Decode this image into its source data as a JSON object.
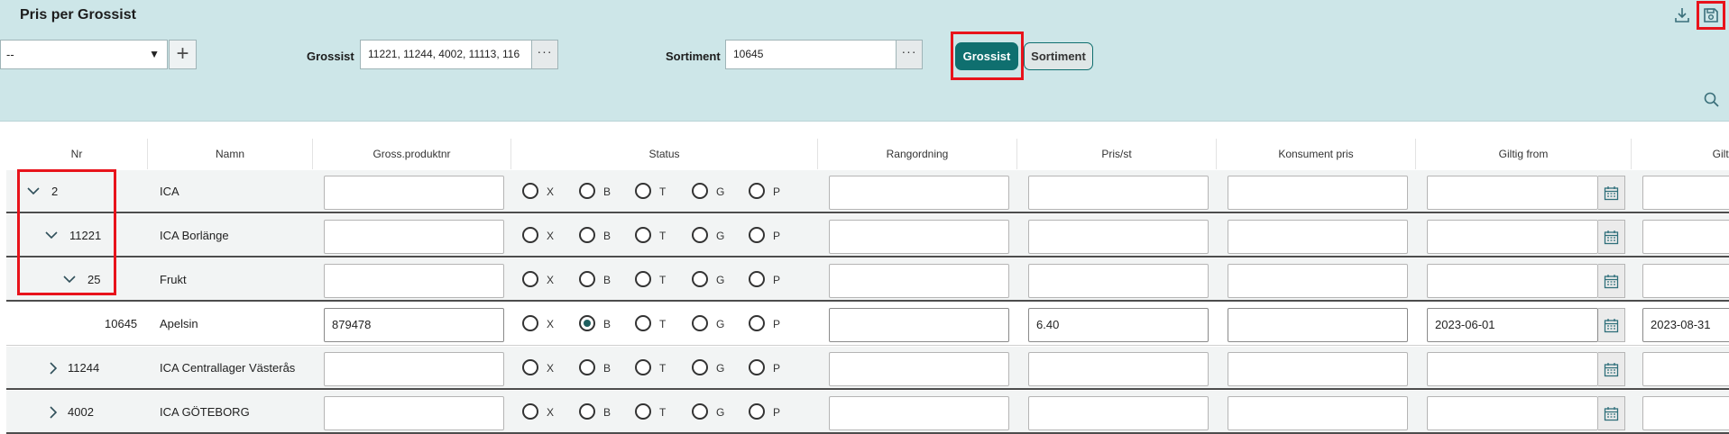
{
  "header": {
    "title": "Pris per Grossist",
    "dropdown_value": "--",
    "grossist_label": "Grossist",
    "grossist_value": "11221, 11244, 4002, 11113, 116",
    "sortiment_label": "Sortiment",
    "sortiment_value": "10645",
    "ellipsis": "···",
    "plus": "+",
    "caret": "▼",
    "btn_grossist": "Grossist",
    "btn_sortiment": "Sortiment"
  },
  "columns": [
    "Nr",
    "Namn",
    "Gross.produktnr",
    "Status",
    "Rangordning",
    "Pris/st",
    "Konsument pris",
    "Giltig from",
    "Gilti"
  ],
  "status_options": [
    "X",
    "B",
    "T",
    "G",
    "P"
  ],
  "rows": [
    {
      "chevron": "expanded",
      "nr": "2",
      "namn": "ICA",
      "gross": "",
      "status": "",
      "rang": "",
      "pris": "",
      "konsument": "",
      "from": "",
      "tom": ""
    },
    {
      "chevron": "expanded",
      "nr": "11221",
      "namn": "ICA Borlänge",
      "gross": "",
      "status": "",
      "rang": "",
      "pris": "",
      "konsument": "",
      "from": "",
      "tom": ""
    },
    {
      "chevron": "expanded",
      "nr": "25",
      "namn": "Frukt",
      "gross": "",
      "status": "",
      "rang": "",
      "pris": "",
      "konsument": "",
      "from": "",
      "tom": ""
    },
    {
      "chevron": "none",
      "nr": "10645",
      "namn": "Apelsin",
      "gross": "879478",
      "status": "B",
      "rang": "",
      "pris": "6.40",
      "konsument": "",
      "from": "2023-06-01",
      "tom": "2023-08-31"
    },
    {
      "chevron": "collapsed",
      "nr": "11244",
      "namn": "ICA Centrallager Västerås",
      "gross": "",
      "status": "",
      "rang": "",
      "pris": "",
      "konsument": "",
      "from": "",
      "tom": ""
    },
    {
      "chevron": "collapsed",
      "nr": "4002",
      "namn": "ICA GÖTEBORG",
      "gross": "",
      "status": "",
      "rang": "",
      "pris": "",
      "konsument": "",
      "from": "",
      "tom": ""
    }
  ],
  "icons": {
    "download": "download-icon",
    "save": "save-icon",
    "search": "search-icon",
    "calendar": "calendar-icon"
  },
  "colors": {
    "header_bg": "#cde6e8",
    "primary": "#0f6f6f",
    "highlight": "#e8131b"
  }
}
